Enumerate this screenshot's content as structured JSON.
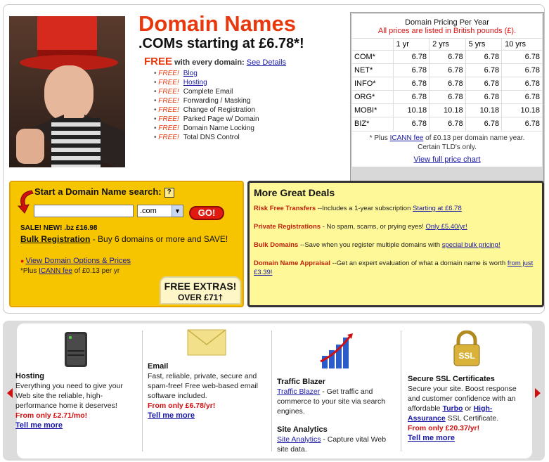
{
  "header": {
    "title": "Domain Names",
    "subtitle": ".COMs starting at £6.78*!",
    "free_word": "FREE",
    "free_with": "with every domain:",
    "see_details": "See Details",
    "free_tag": "FREE!",
    "features": [
      "Blog",
      "Hosting",
      "Complete Email",
      "Forwarding / Masking",
      "Change of Registration",
      "Parked Page w/ Domain",
      "Domain Name Locking",
      "Total DNS Control"
    ]
  },
  "pricing": {
    "title": "Domain Pricing Per Year",
    "note": "All prices are listed in British pounds (£).",
    "columns": [
      "1 yr",
      "2 yrs",
      "5 yrs",
      "10 yrs"
    ],
    "rows": [
      {
        "tld": "COM*",
        "prices": [
          "6.78",
          "6.78",
          "6.78",
          "6.78"
        ]
      },
      {
        "tld": "NET*",
        "prices": [
          "6.78",
          "6.78",
          "6.78",
          "6.78"
        ]
      },
      {
        "tld": "INFO*",
        "prices": [
          "6.78",
          "6.78",
          "6.78",
          "6.78"
        ]
      },
      {
        "tld": "ORG*",
        "prices": [
          "6.78",
          "6.78",
          "6.78",
          "6.78"
        ]
      },
      {
        "tld": "MOBI*",
        "prices": [
          "10.18",
          "10.18",
          "10.18",
          "10.18"
        ]
      },
      {
        "tld": "BIZ*",
        "prices": [
          "6.78",
          "6.78",
          "6.78",
          "6.78"
        ]
      }
    ],
    "foot_prefix": "* Plus",
    "foot_link": "ICANN fee",
    "foot_suffix": "of £0.13 per domain name year.",
    "foot_line2": "Certain TLD's only.",
    "view_full": "View full price chart"
  },
  "search": {
    "title": "Start a Domain Name search:",
    "help": "?",
    "input_value": "",
    "tld_selected": ".com",
    "go_label": "GO!",
    "sale": "SALE! NEW! .bz £16.98",
    "bulk_link": "Bulk Registration",
    "bulk_text": "- Buy 6 domains or more and SAVE!",
    "options_link": "View Domain Options & Prices",
    "icann_prefix": "*Plus",
    "icann_link": "ICANN fee",
    "icann_suffix": "of £0.13 per yr",
    "free_extras_1": "FREE EXTRAS!",
    "free_extras_2": "OVER £71†"
  },
  "deals": {
    "title": "More Great Deals",
    "items": [
      {
        "head": "Risk Free Transfers",
        "text": "--Includes a 1-year subscription",
        "link": "Starting at £6.78"
      },
      {
        "head": "Private Registrations",
        "text": "- No spam, scams, or prying eyes!",
        "link": "Only £5.40/yr!"
      },
      {
        "head": "Bulk Domains",
        "text": "--Save when you register multiple domains with",
        "link": "special bulk pricing!"
      },
      {
        "head": "Domain Name Appraisal",
        "text": "--Get an expert evaluation of what a domain name is worth",
        "link": "from just £3.39!"
      }
    ]
  },
  "products": {
    "hosting": {
      "title": "Hosting",
      "text": "Everything you need to give your Web site the reliable, high-performance home it deserves!",
      "price": "From only £2.71/mo!",
      "tell": "Tell me more"
    },
    "email": {
      "title": "Email",
      "text": "Fast, reliable, private, secure and spam-free! Free web-based email software included.",
      "price": "From only £6.78/yr!",
      "tell": "Tell me more"
    },
    "traffic": {
      "title": "Traffic Blazer",
      "link": "Traffic Blazer",
      "text": "- Get traffic and commerce to your site via search engines."
    },
    "analytics": {
      "title": "Site Analytics",
      "link": "Site Analytics",
      "text": "- Capture vital Web site data."
    },
    "ssl": {
      "title": "Secure SSL Certificates",
      "text1": "Secure your site. Boost response and customer confidence with an affordable",
      "turbo": "Turbo",
      "or": "or",
      "high": "High-Assurance",
      "text2": "SSL Certificate.",
      "price": "From only £20.37/yr!",
      "tell": "Tell me more",
      "badge": "SSL"
    }
  }
}
